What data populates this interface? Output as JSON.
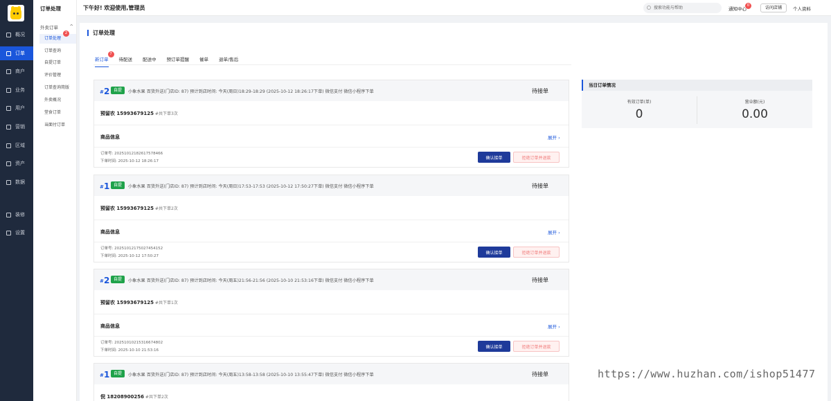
{
  "rail": {
    "items": [
      {
        "label": "概况",
        "active": false
      },
      {
        "label": "订单",
        "active": true
      },
      {
        "label": "商户",
        "active": false
      },
      {
        "label": "业务",
        "active": false
      },
      {
        "label": "用户",
        "active": false
      },
      {
        "label": "营销",
        "active": false
      },
      {
        "label": "区域",
        "active": false
      },
      {
        "label": "资产",
        "active": false
      },
      {
        "label": "数据",
        "active": false
      },
      {
        "label": "装修",
        "active": false
      },
      {
        "label": "设置",
        "active": false
      }
    ]
  },
  "submenu": {
    "title": "订单处理",
    "group": "外卖订单",
    "group_arrow": "^",
    "badge": "2",
    "items": [
      "订单处理",
      "订单查询",
      "自提订单",
      "评价管理",
      "订单查询简版",
      "外卖概况",
      "堂食订单",
      "当面付订单"
    ]
  },
  "topbar": {
    "greeting": "下午好!  欢迎使用,管理员",
    "search_placeholder": "搜索功能与帮助",
    "notice_label": "通知中心",
    "notice_badge": "0",
    "visit_store": "访问店铺",
    "profile": "个人资料"
  },
  "page": {
    "title": "订单处理",
    "tabs": [
      {
        "label": "新订单",
        "badge": "7",
        "active": true
      },
      {
        "label": "待配送",
        "badge": "",
        "active": false
      },
      {
        "label": "配送中",
        "badge": "",
        "active": false
      },
      {
        "label": "预订单提醒",
        "badge": "",
        "active": false
      },
      {
        "label": "催单",
        "badge": "",
        "active": false
      },
      {
        "label": "退单/售后",
        "badge": "",
        "active": false
      }
    ]
  },
  "orders": [
    {
      "hash": "#",
      "number": "2",
      "tag": "自提",
      "info": "小象水果 百货外送(门店ID: 87)   预计到店时间: 今天(周日)18:29-18:29    (2025-10-12 18:26:17下单)  微信支付    微信小程序下单",
      "status": "待接单",
      "customer": "预留农 15993679125",
      "times": " #共下单3次",
      "goods_label": "商品信息",
      "expand": "展开 ›",
      "order_no": "订单号: 20251012182617578466",
      "order_time": "下单时间:  2025-10-12 18:26:17",
      "confirm": "确认接单",
      "refuse": "拒绝订单并退款"
    },
    {
      "hash": "#",
      "number": "1",
      "tag": "自提",
      "info": "小象水果 百货外送(门店ID: 87)   预计到店时间: 今天(周日)17:53-17:53    (2025-10-12 17:50:27下单)  微信支付    微信小程序下单",
      "status": "待接单",
      "customer": "预留农 15993679125",
      "times": " #共下单2次",
      "goods_label": "商品信息",
      "expand": "展开 ›",
      "order_no": "订单号: 20251012175027454152",
      "order_time": "下单时间:  2025-10-12 17:50:27",
      "confirm": "确认接单",
      "refuse": "拒绝订单并退款"
    },
    {
      "hash": "#",
      "number": "2",
      "tag": "自提",
      "info": "小象水果 百货外送(门店ID: 87)   预计到店时间: 今天(周五)21:56-21:56    (2025-10-10 21:53:16下单)  微信支付    微信小程序下单",
      "status": "待接单",
      "customer": "预留农 15993679125",
      "times": " #共下单1次",
      "goods_label": "商品信息",
      "expand": "展开 ›",
      "order_no": "订单号: 20251010215316674802",
      "order_time": "下单时间:  2025-10-10 21:53:16",
      "confirm": "确认接单",
      "refuse": "拒绝订单并退款"
    },
    {
      "hash": "#",
      "number": "1",
      "tag": "自提",
      "info": "小象水果 百货外送(门店ID: 87)   预计到店时间: 今天(周五)13:58-13:58    (2025-10-10 13:55:47下单)  微信支付    微信小程序下单",
      "status": "待接单",
      "customer": "倪 18208900256",
      "times": " #共下单2次"
    }
  ],
  "stats": {
    "title": "当日订单情况",
    "valid_label": "有效订单(单)",
    "valid_value": "0",
    "revenue_label": "营业额(元)",
    "revenue_value": "0.00"
  },
  "watermark": "https://www.huzhan.com/ishop51477",
  "colors": {
    "accent": "#1a56db",
    "rail": "#1f2a3d",
    "tag": "#1fa24a",
    "badge": "#f05252"
  }
}
